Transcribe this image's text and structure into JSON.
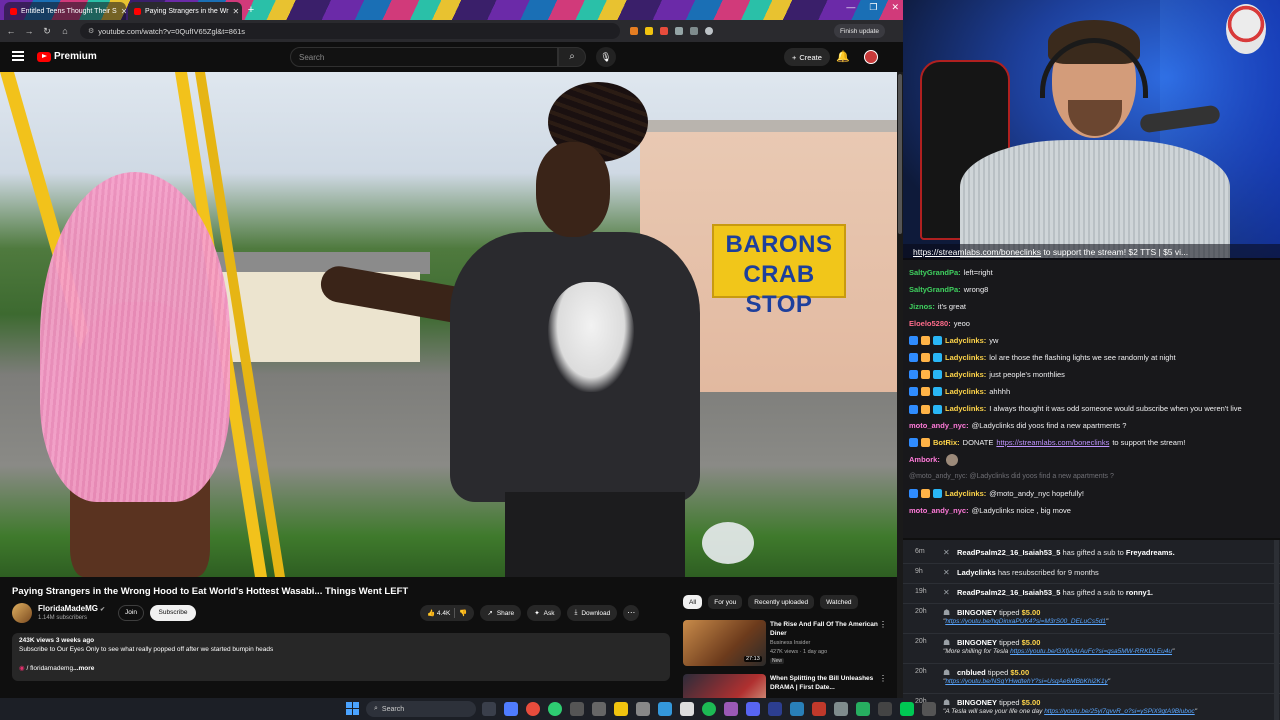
{
  "browser": {
    "tabs": [
      {
        "title": "Entitled Teens Thought Their S",
        "active": false
      },
      {
        "title": "Paying Strangers in the Wr",
        "active": true
      }
    ],
    "url": "youtube.com/watch?v=0QufIV65Zgl&t=861s",
    "finish_update": "Finish update",
    "window_controls": [
      "—",
      "❐",
      "✕"
    ]
  },
  "youtube": {
    "logo_text": "Premium",
    "search_placeholder": "Search",
    "create_label": "Create",
    "video": {
      "sign_line1": "BARONS",
      "sign_line2": "CRAB STOP",
      "title": "Paying Strangers in the Wrong Hood to Eat World's Hottest Wasabi... Things Went LEFT",
      "channel": "FloridaMadeMG",
      "subscribers": "1.14M subscribers",
      "join": "Join",
      "subscribe": "Subscribe",
      "likes": "4.4K",
      "share": "Share",
      "ask": "Ask",
      "download": "Download",
      "views_age": "243K views  3 weeks ago",
      "description": "Subscribe to Our Eyes Only to see what really popped off after we started bumpin heads",
      "desc_link": "/ floridamademg",
      "more": "...more"
    },
    "filters": [
      "All",
      "For you",
      "Recently uploaded",
      "Watched"
    ],
    "recommendations": [
      {
        "title": "The Rise And Fall Of The American Diner",
        "channel": "Business Insider",
        "stats": "427K views · 1 day ago",
        "badge": "New",
        "duration": "27:13"
      },
      {
        "title": "When Splitting the Bill Unleashes DRAMA | First Date...",
        "channel": "",
        "stats": "",
        "badge": "",
        "duration": ""
      }
    ]
  },
  "stream": {
    "banner_link": "https://streamlabs.com/boneclinks",
    "banner_text": " to support the stream! $2 TTS | $5 vi..."
  },
  "chat": [
    {
      "user": "SaltyGrandPa",
      "color": "#3fd15f",
      "text": "left=right",
      "badges": 0
    },
    {
      "user": "SaltyGrandPa",
      "color": "#3fd15f",
      "text": "wrong8",
      "badges": 0
    },
    {
      "user": "Jiznos",
      "color": "#3fd15f",
      "text": "it's great",
      "badges": 0
    },
    {
      "user": "Eloelo5280",
      "color": "#ff6b8a",
      "text": "yeoo",
      "badges": 0
    },
    {
      "user": "Ladyclinks",
      "color": "#ffd54a",
      "text": "yw",
      "badges": 3
    },
    {
      "user": "Ladyclinks",
      "color": "#ffd54a",
      "text": "lol are those the flashing lights we see randomly at night",
      "badges": 3
    },
    {
      "user": "Ladyclinks",
      "color": "#ffd54a",
      "text": "just people's monthlies",
      "badges": 3
    },
    {
      "user": "Ladyclinks",
      "color": "#ffd54a",
      "text": "ahhhh",
      "badges": 3
    },
    {
      "user": "Ladyclinks",
      "color": "#ffd54a",
      "text": "I always thought it was odd someone would subscribe when you weren't live",
      "badges": 3
    },
    {
      "user": "moto_andy_nyc",
      "color": "#ff7ad9",
      "text": "@Ladyclinks did yoos find a new apartments ?",
      "badges": 0
    },
    {
      "user": "BotRix",
      "color": "#ffd54a",
      "text": "DONATE ",
      "link": "https://streamlabs.com/boneclinks",
      "after": " to support the stream!",
      "badges": 2
    },
    {
      "user": "Ambork",
      "color": "#ff7ad9",
      "text": "",
      "badges": 0,
      "emote": true
    },
    {
      "user": "",
      "color": "#6f6f75",
      "text": "@moto_andy_nyc: @Ladyclinks did yoos find a new apartments ?",
      "badges": 0,
      "dim": true
    },
    {
      "user": "Ladyclinks",
      "color": "#ffd54a",
      "text": "@moto_andy_nyc hopefully!",
      "badges": 3
    },
    {
      "user": "moto_andy_nyc",
      "color": "#ff7ad9",
      "text": "@Ladyclinks noice , big move",
      "badges": 0
    }
  ],
  "feed": [
    {
      "ago": "6m",
      "user": "ReadPsalm22_16_Isaiah53_5",
      "text": " has gifted a sub to ",
      "target": "Freyadreams."
    },
    {
      "ago": "9h",
      "user": "Ladyclinks",
      "text": " has resubscribed for 9 months",
      "target": ""
    },
    {
      "ago": "19h",
      "user": "ReadPsalm22_16_Isaiah53_5",
      "text": " has gifted a sub to ",
      "target": "ronny1."
    },
    {
      "ago": "20h",
      "user": "BINGONEY",
      "text": " tipped ",
      "amount": "$5.00",
      "msg": "",
      "link": "https://youtu.be/hqDinxaPUK4?si=M3rS00_DELuCs5d1"
    },
    {
      "ago": "20h",
      "user": "BINGONEY",
      "text": " tipped ",
      "amount": "$5.00",
      "msg": "More shilling for Tesla ",
      "link": "https://youtu.be/GXfjAArAuFc?si=qsa5MW-RRKDLEu4u"
    },
    {
      "ago": "20h",
      "user": "cnblued",
      "text": " tipped ",
      "amount": "$5.00",
      "msg": "",
      "link": "https://youtu.be/NSgYHwdtehY?si=UsqAe6MBbKhi2K1y"
    },
    {
      "ago": "20h",
      "user": "BINGONEY",
      "text": " tipped ",
      "amount": "$5.00",
      "msg": "A Tesla will save your life one day ",
      "link": "https://youtu.be/25yl7gvvR_o?si=ySPiX9gtA9Bluboc"
    }
  ],
  "taskbar": {
    "search_placeholder": "Search"
  }
}
